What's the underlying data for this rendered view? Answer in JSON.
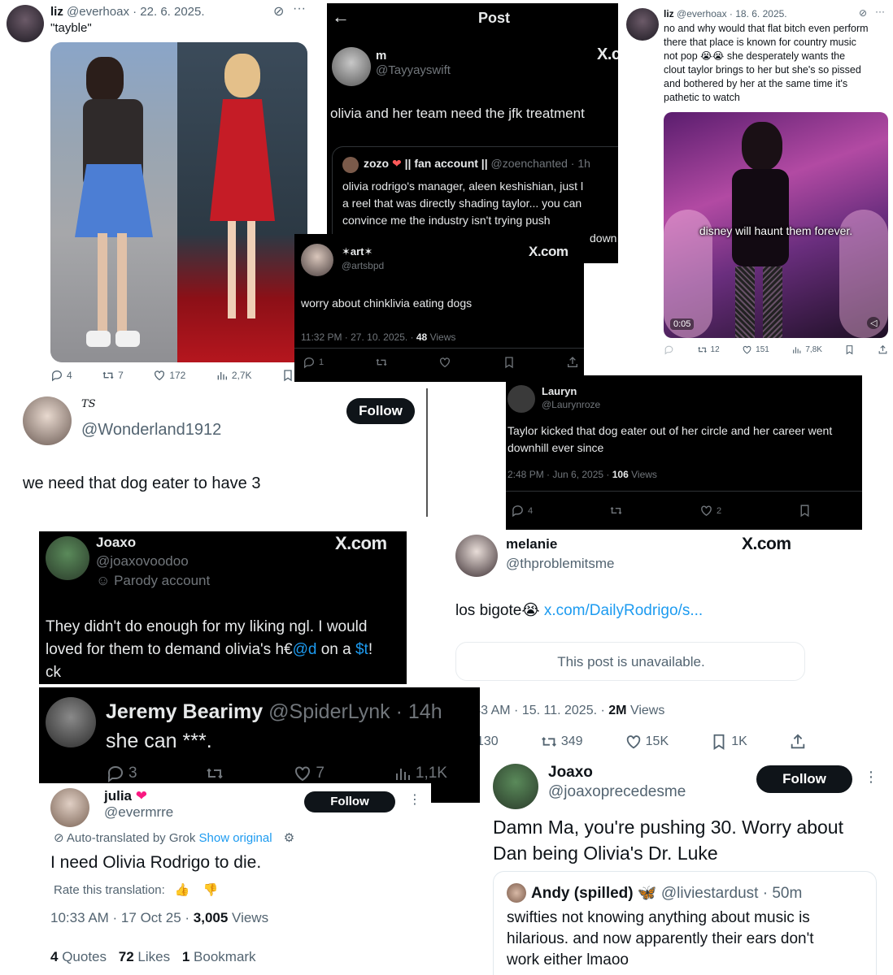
{
  "c1": {
    "name": "liz",
    "handle": "@everhoax",
    "date": "22. 6. 2025.",
    "text": "\"tayble\"",
    "replies": "4",
    "reposts": "7",
    "likes": "172",
    "views": "2,7K"
  },
  "c2": {
    "header": "Post",
    "name": "m",
    "handle": "@Tayyayswift",
    "brand": "X.c",
    "text": "olivia and her team need the jfk treatment",
    "quote_name": "zozo",
    "quote_badge": "|| fan account ||",
    "quote_handle": "@zoenchanted · 1h",
    "quote_lines": [
      "olivia rodrigo's manager, aleen keshishian, just l",
      "a reel that was directly shading taylor... you can",
      "convince me the industry isn't trying push"
    ],
    "overlap_text": "down"
  },
  "c3": {
    "name": "liz",
    "handle": "@everhoax",
    "date": "18. 6. 2025.",
    "lines": [
      "no and why would that flat bitch even perform",
      "there that place is known for country music",
      "not pop 😭😭 she desperately wants the",
      "clout taylor brings to her but she's so pissed",
      "and bothered by her at the same time it's",
      "pathetic to watch"
    ],
    "caption": "disney will haunt them forever.",
    "time": "0:05",
    "reposts": "12",
    "likes": "151",
    "views": "7,8K"
  },
  "c4": {
    "name": "✶art✶",
    "handle": "@artsbpd",
    "brand": "X.com",
    "text": "worry about chinklivia eating dogs",
    "meta": "11:32 PM · 27. 10. 2025. · ",
    "views_num": "48",
    "views_label": "Views",
    "replies": "1"
  },
  "c5": {
    "name": "TS",
    "handle": "@Wonderland1912",
    "follow": "Follow",
    "text": "we need that dog eater to have 3"
  },
  "c6": {
    "name": "Lauryn",
    "handle": "@Laurynroze",
    "lines": [
      "Taylor kicked that dog eater out of her circle and her career went",
      "downhill ever since"
    ],
    "meta": "2:48 PM · Jun 6, 2025 · ",
    "views_num": "106",
    "views_label": "Views",
    "replies": "4",
    "likes": "2"
  },
  "c7": {
    "name": "Joaxo",
    "handle": "@joaxovoodoo",
    "parody": "Parody account",
    "brand": "X.com",
    "line1": "They didn't do enough for my liking ngl. I would",
    "line2a": "loved for them to demand olivia's h€",
    "line2b": "@d",
    "line2c": " on a ",
    "line2d": "$t",
    "line2e": "!",
    "line3": "ck"
  },
  "c8": {
    "name": "melanie",
    "handle": "@thproblemitsme",
    "brand": "X.com",
    "text": "los bigote😭",
    "link": "x.com/DailyRodrigo/s...",
    "unavailable": "This post is unavailable.",
    "meta": "12:43 AM · 15. 11. 2025. · ",
    "views_num": "2M",
    "views_label": "Views",
    "replies": "130",
    "reposts": "349",
    "likes": "15K",
    "bookmarks": "1K"
  },
  "c9": {
    "name": "Jeremy Bearimy",
    "handle": "@SpiderLynk · 14h",
    "text": "she can ***.",
    "replies": "3",
    "likes": "7",
    "views": "1,1K"
  },
  "c10": {
    "name": "julia",
    "handle": "@evermrre",
    "follow": "Follow",
    "translated": "Auto-translated by Grok",
    "show_original": "Show original",
    "text": "I need Olivia Rodrigo to die.",
    "rate": "Rate this translation:",
    "meta": "10:33 AM · 17 Oct 25 · ",
    "views_num": "3,005",
    "views_label": "Views",
    "quotes_num": "4",
    "quotes_label": "Quotes",
    "likes_num": "72",
    "likes_label": "Likes",
    "bm_num": "1",
    "bm_label": "Bookmark"
  },
  "c11": {
    "name": "Joaxo",
    "handle": "@joaxoprecedesme",
    "follow": "Follow",
    "line1": "Damn Ma, you're pushing 30. Worry about",
    "line2": "Dan being Olivia's Dr. Luke",
    "quote_name": "Andy (spilled)",
    "quote_handle": "@liviestardust · 50m",
    "quote_lines": [
      "swifties not knowing anything about music is",
      "hilarious. and now apparently their ears don't",
      "work either lmaoo"
    ]
  },
  "colors": {
    "accent": "#1d9bf0",
    "dark_bg": "#000000",
    "muted": "#71767b",
    "pink_like": "#f91880"
  }
}
